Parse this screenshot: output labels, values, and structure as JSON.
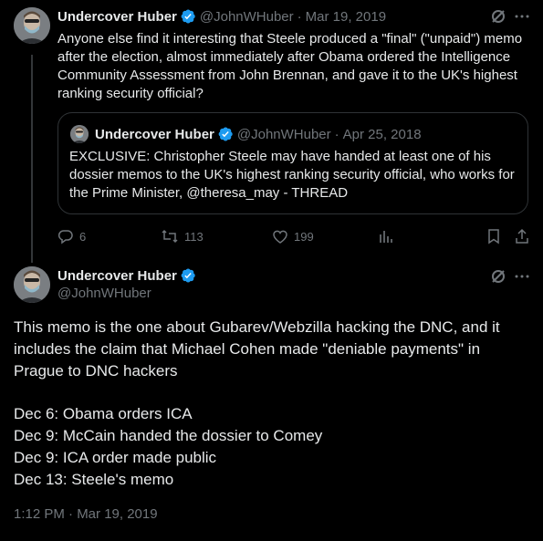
{
  "first_tweet": {
    "author_name": "Undercover Huber",
    "handle": "@JohnWHuber",
    "separator": "·",
    "date": "Mar 19, 2019",
    "text": "Anyone else find it interesting that Steele produced a \"final\" (\"unpaid\") memo after the election, almost immediately after Obama ordered the Intelligence Community Assessment from John Brennan, and gave it to the UK's highest ranking security official?",
    "quoted": {
      "author_name": "Undercover Huber",
      "handle": "@JohnWHuber",
      "separator": "·",
      "date": "Apr 25, 2018",
      "text": "EXCLUSIVE: Christopher Steele may have handed at least one of his dossier memos to the UK's highest ranking security official, who works for the Prime Minister, @theresa_may - THREAD"
    },
    "actions": {
      "replies": "6",
      "reposts": "113",
      "likes": "199"
    }
  },
  "main_tweet": {
    "author_name": "Undercover Huber",
    "handle": "@JohnWHuber",
    "text_paragraph": "This memo is the one about Gubarev/Webzilla hacking the DNC, and it includes the claim that Michael Cohen made \"deniable payments\" in Prague to DNC hackers",
    "timeline": [
      "Dec 6: Obama orders ICA",
      "Dec 9: McCain handed the dossier to Comey",
      "Dec 9: ICA order made public",
      "Dec 13: Steele's memo"
    ],
    "timestamp": "1:12 PM · Mar 19, 2019"
  },
  "colors": {
    "background": "#000000",
    "text": "#e7e9ea",
    "muted": "#71767b",
    "verified": "#1d9bf0",
    "border": "#2f3336"
  },
  "icons": [
    "verified-badge-icon",
    "grok-icon",
    "more-icon",
    "reply-icon",
    "repost-icon",
    "like-icon",
    "views-icon",
    "bookmark-icon",
    "share-icon"
  ]
}
